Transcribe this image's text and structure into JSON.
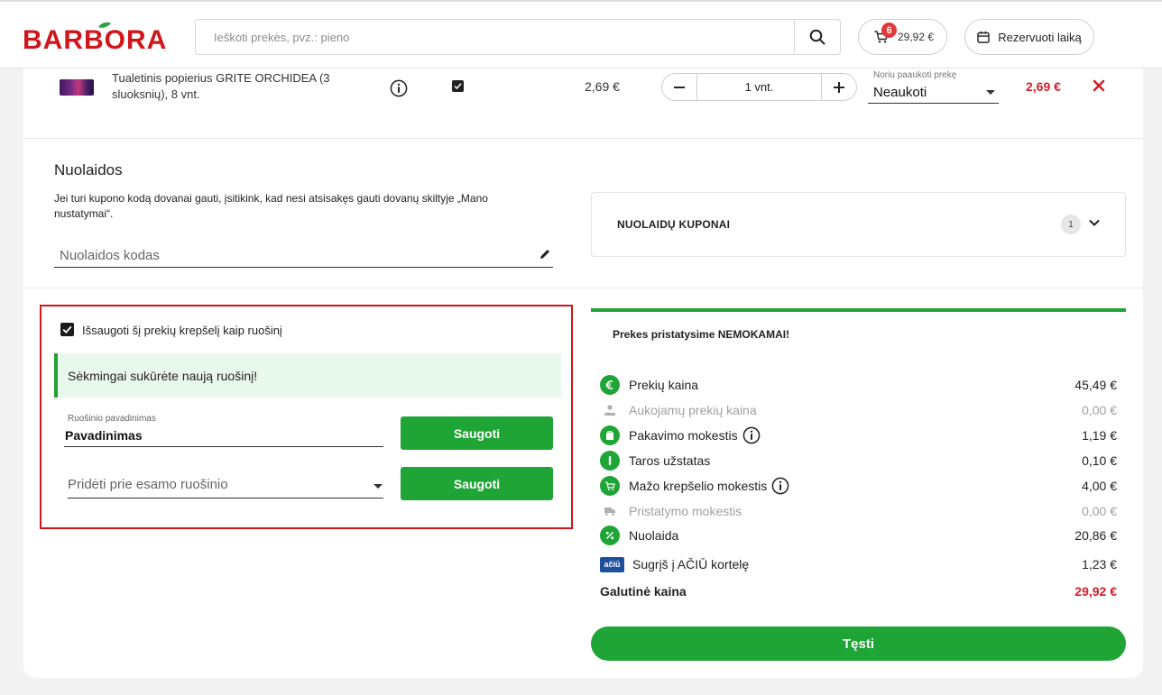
{
  "header": {
    "logo_text": "BARBORA",
    "search_placeholder": "Ieškoti prekės, pvz.: pieno",
    "cart_count": "6",
    "cart_total": "29,92 €",
    "reserve_label": "Rezervuoti laiką"
  },
  "product": {
    "name": "Tualetinis popierius GRITE ORCHIDEA (3 sluoksnių), 8 vnt.",
    "unit_price": "2,69 €",
    "quantity": "1 vnt.",
    "substitute_label": "Noriu paaukoti prekę",
    "substitute_value": "Neaukoti",
    "total": "2,69 €"
  },
  "discounts": {
    "title": "Nuolaidos",
    "note": "Jei turi kupono kodą dovanai gauti, įsitikink, kad nesi atsisakęs gauti dovanų skiltyje „Mano nustatymai“.",
    "code_placeholder": "Nuolaidos kodas",
    "coupons_label": "NUOLAIDŲ KUPONAI",
    "coupons_count": "1"
  },
  "save_cart": {
    "checkbox_label": "Išsaugoti šį prekių krepšelį kaip ruošinį",
    "success_message": "Sėkmingai sukūrėte naują ruošinį!",
    "name_field_label": "Ruošinio pavadinimas",
    "name_field_value": "Pavadinimas",
    "existing_placeholder": "Pridėti prie esamo ruošinio",
    "save_button": "Saugoti",
    "save_button_2": "Saugoti"
  },
  "summary": {
    "free_delivery": "Prekes pristatysime NEMOKAMAI!",
    "rows": [
      {
        "label": "Prekių kaina",
        "value": "45,49 €"
      },
      {
        "label": "Aukojamų prekių kaina",
        "value": "0,00 €"
      },
      {
        "label": "Pakavimo mokestis",
        "value": "1,19 €"
      },
      {
        "label": "Taros užstatas",
        "value": "0,10 €"
      },
      {
        "label": "Mažo krepšelio mokestis",
        "value": "4,00 €"
      },
      {
        "label": "Pristatymo mokestis",
        "value": "0,00 €"
      },
      {
        "label": "Nuolaida",
        "value": "20,86 €"
      },
      {
        "label": "Sugrįš į AČIŪ kortelę",
        "value": "1,23 €"
      }
    ],
    "aciu_badge": "ačiū",
    "final_label": "Galutinė kaina",
    "final_value": "29,92 €",
    "continue_label": "Tęsti"
  },
  "colors": {
    "brand_red": "#d0161b",
    "accent_green": "#1fa535",
    "price_red": "#d0202a"
  }
}
